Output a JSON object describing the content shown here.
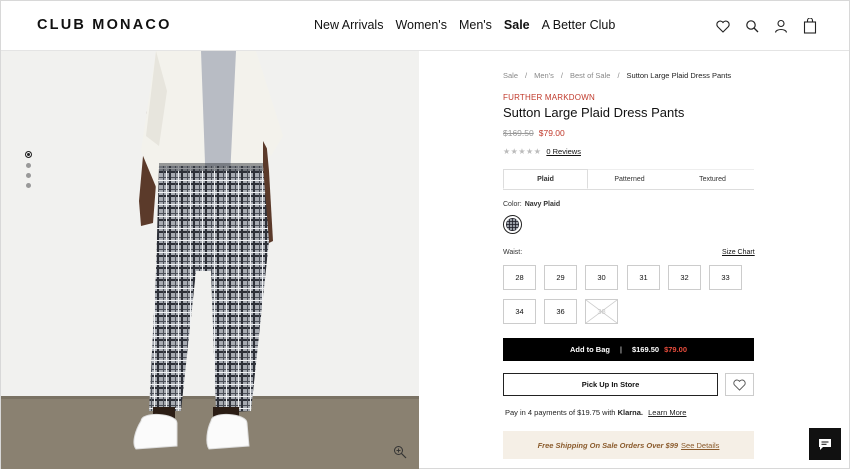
{
  "header": {
    "logo": "CLUB MONACO",
    "nav": [
      "New Arrivals",
      "Women's",
      "Men's",
      "Sale",
      "A Better Club"
    ],
    "active_nav": "Sale",
    "icons": [
      "heart-icon",
      "search-icon",
      "account-icon",
      "bag-icon"
    ]
  },
  "gallery": {
    "image_count": 4,
    "active_index": 0
  },
  "breadcrumb": [
    "Sale",
    "Men's",
    "Best of Sale",
    "Sutton Large Plaid Dress Pants"
  ],
  "product": {
    "badge": "FURTHER MARKDOWN",
    "name": "Sutton Large Plaid Dress Pants",
    "price_original": "$169.50",
    "price_sale": "$79.00",
    "rating_stars": 0,
    "reviews": "0 Reviews"
  },
  "pattern_tabs": {
    "items": [
      "Plaid",
      "Patterned",
      "Textured"
    ],
    "active": "Plaid"
  },
  "color": {
    "label": "Color:",
    "value": "Navy Plaid"
  },
  "waist": {
    "label": "Waist:",
    "size_chart": "Size Chart",
    "sizes": [
      {
        "label": "28",
        "available": true
      },
      {
        "label": "29",
        "available": true
      },
      {
        "label": "30",
        "available": true
      },
      {
        "label": "31",
        "available": true
      },
      {
        "label": "32",
        "available": true
      },
      {
        "label": "33",
        "available": true
      },
      {
        "label": "34",
        "available": true
      },
      {
        "label": "36",
        "available": true
      },
      {
        "label": "38",
        "available": false
      }
    ]
  },
  "actions": {
    "add_to_bag": "Add to Bag",
    "separator": "|",
    "bag_price_original": "$169.50",
    "bag_price_sale": "$79.00",
    "pickup": "Pick Up In Store"
  },
  "klarna": {
    "text": "Pay in 4 payments of $19.75 with",
    "brand": "Klarna.",
    "link": "Learn More"
  },
  "shipping": {
    "text": "Free Shipping On Sale Orders Over $99",
    "link": "See Details"
  },
  "colors": {
    "sale_red": "#c0392b",
    "button_black": "#000000",
    "shipping_bg": "#f5efe6"
  }
}
